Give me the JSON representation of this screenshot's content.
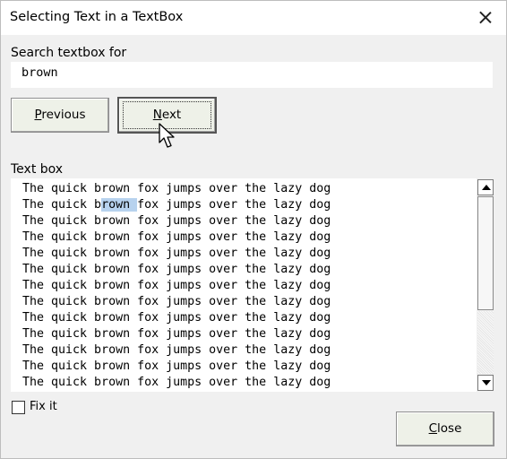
{
  "window": {
    "title": "Selecting Text in a TextBox"
  },
  "search": {
    "label": "Search textbox for",
    "value": "brown"
  },
  "buttons": {
    "previous": {
      "pre": "",
      "accel": "P",
      "post": "revious"
    },
    "next": {
      "pre": "",
      "accel": "N",
      "post": "ext"
    },
    "close": {
      "pre": "",
      "accel": "C",
      "post": "lose"
    }
  },
  "textbox": {
    "label": "Text box",
    "lines": [
      "The quick brown fox jumps over the lazy dog",
      "The quick brown fox jumps over the lazy dog",
      "The quick brown fox jumps over the lazy dog",
      "The quick brown fox jumps over the lazy dog",
      "The quick brown fox jumps over the lazy dog",
      "The quick brown fox jumps over the lazy dog",
      "The quick brown fox jumps over the lazy dog",
      "The quick brown fox jumps over the lazy dog",
      "The quick brown fox jumps over the lazy dog",
      "The quick brown fox jumps over the lazy dog",
      "The quick brown fox jumps over the lazy dog",
      "The quick brown fox jumps over the lazy dog",
      "The quick brown fox jumps over the lazy dog"
    ],
    "selection": {
      "line_index": 1,
      "before": "The quick b",
      "selected": "rown ",
      "after": "fox jumps over the lazy dog"
    }
  },
  "fix_it": {
    "label": "Fix it",
    "checked": false
  },
  "icons": {
    "close": "close-icon",
    "scroll_up": "scroll-up-arrow-icon",
    "scroll_down": "scroll-down-arrow-icon",
    "cursor": "mouse-pointer-icon"
  },
  "colors": {
    "selection": "#b7d2ee",
    "button_face": "#eef1e8",
    "dialog_bg": "#f0f0f0"
  }
}
